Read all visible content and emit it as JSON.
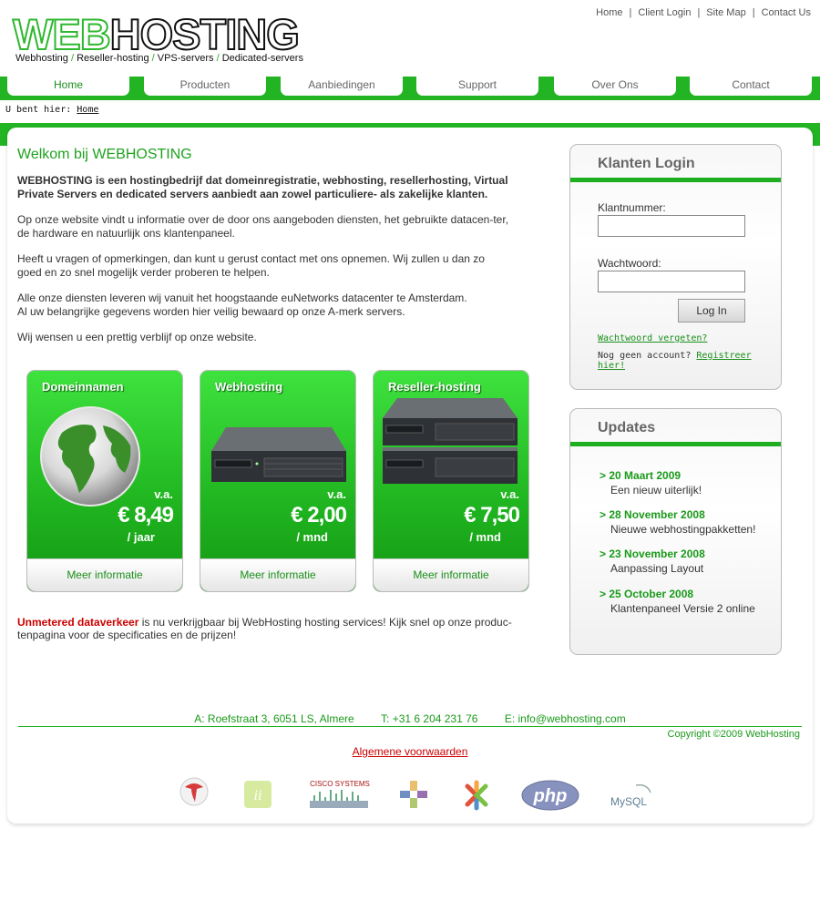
{
  "header": {
    "logo_part1": "WEB",
    "logo_part2": "HOSTING",
    "tagline": [
      "Webhosting",
      "Reseller-hosting",
      "VPS-servers",
      "Dedicated-servers"
    ],
    "tagline_sep": "/",
    "top_links": [
      "Home",
      "Client Login",
      "Site Map",
      "Contact Us"
    ],
    "top_link_sep": "|"
  },
  "nav": {
    "tabs": [
      "Home",
      "Producten",
      "Aanbiedingen",
      "Support",
      "Over Ons",
      "Contact"
    ],
    "active": "Home"
  },
  "breadcrumb": {
    "prefix": "U bent hier:",
    "current": "Home"
  },
  "main": {
    "title": "Welkom bij WEBHOSTING",
    "intro": "WEBHOSTING is een hostingbedrijf dat domeinregistratie, webhosting, resellerhosting, Virtual Private Servers en dedicated servers aanbiedt aan zowel particuliere- als zakelijke klanten.",
    "p1": "Op onze website vindt u informatie over de door ons aangeboden diensten, het gebruikte datacen-ter, de hardware en natuurlijk ons klantenpaneel.",
    "p2": "Heeft u vragen of opmerkingen, dan kunt u gerust contact met ons opnemen. Wij zullen u dan zo goed en zo snel mogelijk verder proberen te helpen.",
    "p3a": "Alle onze diensten leveren wij vanuit het hoogstaande euNetworks datacenter te Amsterdam.",
    "p3b": "Al uw belangrijke gegevens worden hier veilig bewaard op onze A-merk servers.",
    "p4": "Wij wensen u een prettig verblijf op onze website."
  },
  "products": [
    {
      "title": "Domeinnamen",
      "va": "v.a.",
      "price": "€ 8,49",
      "per": "/ jaar",
      "more": "Meer informatie",
      "icon": "globe-icon"
    },
    {
      "title": "Webhosting",
      "va": "v.a.",
      "price": "€ 2,00",
      "per": "/ mnd",
      "more": "Meer informatie",
      "icon": "server-icon"
    },
    {
      "title": "Reseller-hosting",
      "va": "v.a.",
      "price": "€ 7,50",
      "per": "/ mnd",
      "more": "Meer informatie",
      "icon": "server-stack-icon"
    }
  ],
  "unmetered": {
    "link": "Unmetered dataverkeer",
    "text": " is nu verkrijgbaar bij WebHosting hosting services! Kijk snel op onze produc-tenpagina voor de specificaties en de prijzen!"
  },
  "login": {
    "title": "Klanten Login",
    "user_label": "Klantnummer:",
    "user_value": "",
    "pass_label": "Wachtwoord:",
    "pass_value": "",
    "button": "Log In",
    "forgot": "Wachtwoord vergeten?",
    "no_account": "Nog geen account?",
    "register": "Registreer hier!"
  },
  "updates": {
    "title": "Updates",
    "items": [
      {
        "date": "> 20 Maart 2009",
        "text": "Een nieuw uiterlijk!"
      },
      {
        "date": "> 28 November 2008",
        "text": "Nieuwe webhostingpakketten!"
      },
      {
        "date": "> 23 November 2008",
        "text": "Aanpassing Layout"
      },
      {
        "date": "> 25 October 2008",
        "text": "Klantenpaneel Versie 2 online"
      }
    ]
  },
  "footer": {
    "address": "A: Roefstraat 3, 6051 LS, Almere",
    "phone": "T: +31 6 204 231 76",
    "email": "E: info@webhosting.com",
    "copyright": "Copyright ©2009 WebHosting",
    "terms": "Algemene voorwaarden",
    "partners": [
      "red-swirl-logo-icon",
      "green-ii-logo-icon",
      "CISCO SYSTEMS",
      "centos-logo-icon",
      "joomla-logo-icon",
      "php",
      "MySQL"
    ]
  },
  "colors": {
    "brand_green": "#22b422",
    "link_red": "#cc0000",
    "text_green": "#1a9a1a"
  }
}
